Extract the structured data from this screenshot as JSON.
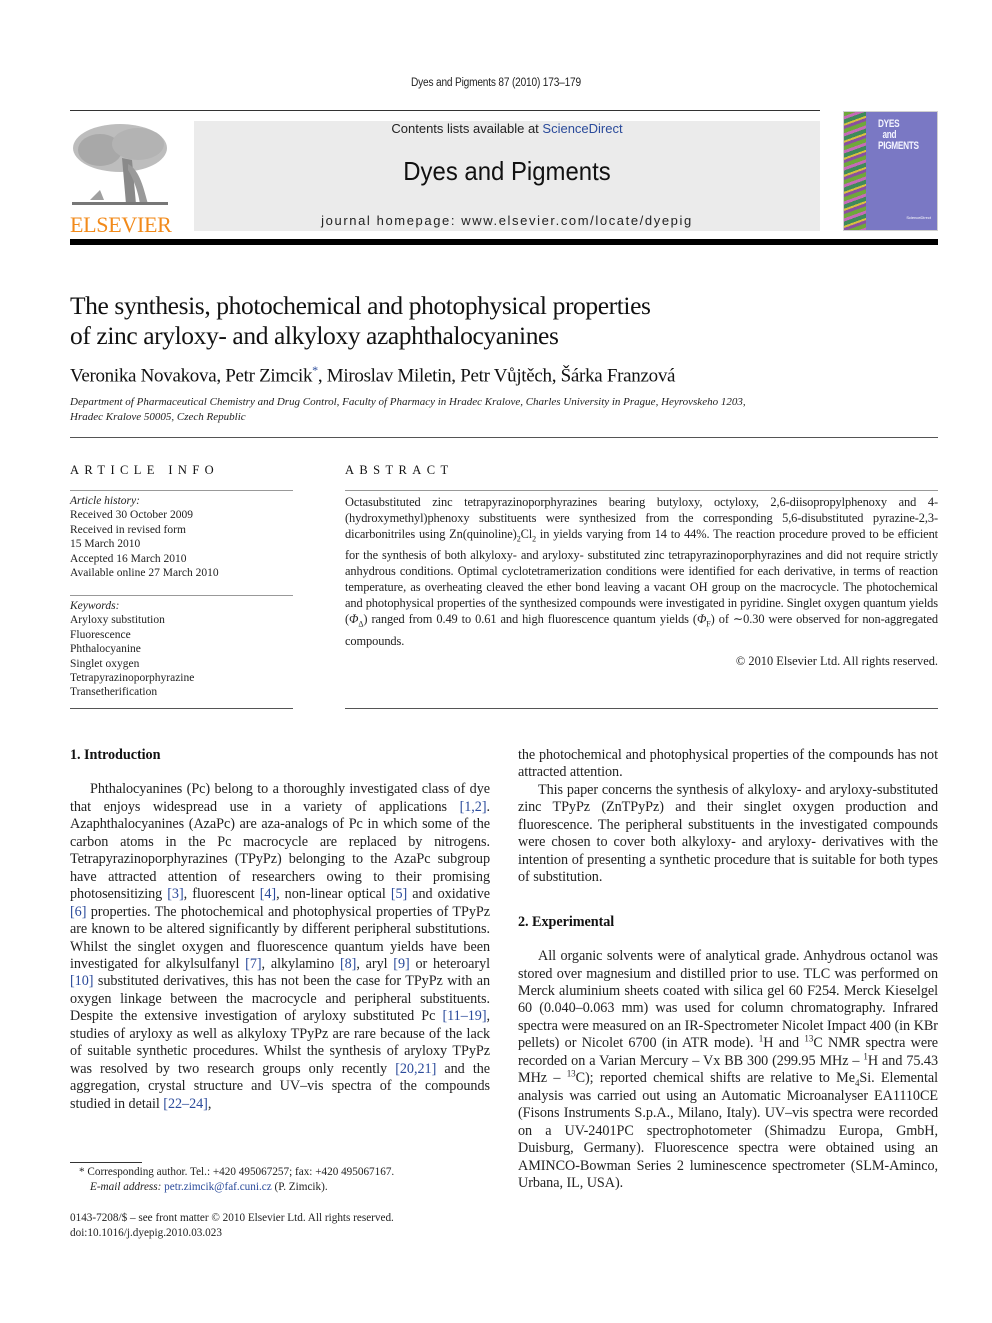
{
  "running_head": "Dyes and Pigments 87 (2010) 173–179",
  "header": {
    "publisher_logo_text": "ELSEVIER",
    "contents_prefix": "Contents lists available at ",
    "contents_link": "ScienceDirect",
    "journal_title": "Dyes and Pigments",
    "homepage_label": "journal homepage: www.elsevier.com/locate/dyepig",
    "cover_title_lines": [
      "DYES",
      "and",
      "PIGMENTS"
    ],
    "cover_footer": "ScienceDirect",
    "colors": {
      "elsevier_orange": "#f28a1a",
      "link_blue": "#2a4a9a",
      "banner_grey": "#ebebeb",
      "cover_purple": "#7a78c4"
    }
  },
  "article": {
    "title_line1": "The synthesis, photochemical and photophysical properties",
    "title_line2": "of zinc aryloxy- and alkyloxy azaphthalocyanines",
    "authors": [
      {
        "name": "Veronika Novakova",
        "sep": ", "
      },
      {
        "name": "Petr Zimcik",
        "mark": "*",
        "sep": ", "
      },
      {
        "name": "Miroslav Miletin",
        "sep": ", "
      },
      {
        "name": "Petr Vůjtěch",
        "sep": ", "
      },
      {
        "name": "Šárka Franzová",
        "sep": ""
      }
    ],
    "affiliation_line1": "Department of Pharmaceutical Chemistry and Drug Control, Faculty of Pharmacy in Hradec Kralove, Charles University in Prague, Heyrovskeho 1203,",
    "affiliation_line2": "Hradec Kralove 50005, Czech Republic"
  },
  "article_info": {
    "heading": "ARTICLE INFO",
    "history_label": "Article history:",
    "history": [
      "Received 30 October 2009",
      "Received in revised form",
      "15 March 2010",
      "Accepted 16 March 2010",
      "Available online 27 March 2010"
    ],
    "keywords_label": "Keywords:",
    "keywords": [
      "Aryloxy substitution",
      "Fluorescence",
      "Phthalocyanine",
      "Singlet oxygen",
      "Tetrapyrazinoporphyrazine",
      "Transetherification"
    ]
  },
  "abstract": {
    "heading": "ABSTRACT",
    "text_a": "Octasubstituted zinc tetrapyrazinoporphyrazines bearing butyloxy, octyloxy, 2,6-diisopropylphenoxy and 4-(hydroxymethyl)phenoxy substituents were synthesized from the corresponding 5,6-disubstituted pyrazine-2,3-dicarbonitriles using Zn(quinoline)",
    "sub_2": "2",
    "text_b": "Cl",
    "text_c": " in yields varying from 14 to 44%. The reaction procedure proved to be efficient for the synthesis of both alkyloxy- and aryloxy- substituted zinc tetrapyrazinoporphyrazines and did not require strictly anhydrous conditions. Optimal cyclotetramerization conditions were identified for each derivative, in terms of reaction temperature, as overheating cleaved the ether bond leaving a vacant OH group on the macrocycle. The photochemical and photophysical properties of the synthesized compounds were investigated in pyridine. Singlet oxygen quantum yields (",
    "phi": "Φ",
    "delta": "Δ",
    "text_d": ") ranged from 0.49 to 0.61 and high fluorescence quantum yields (",
    "F": "F",
    "text_e": ") of ∼0.30 were observed for non-aggregated compounds.",
    "copyright": "© 2010 Elsevier Ltd. All rights reserved."
  },
  "body": {
    "intro_heading": "1.  Introduction",
    "intro_p1": [
      {
        "t": "Phthalocyanines (Pc) belong to a thoroughly investigated class of dye that enjoys widespread use in a variety of applications "
      },
      {
        "ref": "[1,2]"
      },
      {
        "t": ". Azaphthalocyanines (AzaPc) are aza-analogs of Pc in which some of the carbon atoms in the Pc macrocycle are replaced by nitrogens. Tetrapyrazinoporphyrazines (TPyPz) belonging to the AzaPc subgroup have attracted attention of researchers owing to their promising photosensitizing "
      },
      {
        "ref": "[3]"
      },
      {
        "t": ", fluorescent "
      },
      {
        "ref": "[4]"
      },
      {
        "t": ", non-linear optical "
      },
      {
        "ref": "[5]"
      },
      {
        "t": " and oxidative "
      },
      {
        "ref": "[6]"
      },
      {
        "t": " properties. The photochemical and photophysical properties of TPyPz are known to be altered significantly by different peripheral substitutions. Whilst the singlet oxygen and fluorescence quantum yields have been investigated for alkylsulfanyl "
      },
      {
        "ref": "[7]"
      },
      {
        "t": ", alkylamino "
      },
      {
        "ref": "[8]"
      },
      {
        "t": ", aryl "
      },
      {
        "ref": "[9]"
      },
      {
        "t": " or heteroaryl "
      },
      {
        "ref": "[10]"
      },
      {
        "t": " substituted derivatives, this has not been the case for TPyPz with an oxygen linkage between the macrocycle and peripheral substituents. Despite the extensive investigation of aryloxy substituted Pc "
      },
      {
        "ref": "[11–19]"
      },
      {
        "t": ", studies of aryloxy as well as alkyloxy TPyPz are rare because of the lack of suitable synthetic procedures. Whilst the synthesis of aryloxy TPyPz was resolved by two research groups only recently "
      },
      {
        "ref": "[20,21]"
      },
      {
        "t": " and the aggregation, crystal structure and UV–vis spectra of the compounds studied in detail "
      },
      {
        "ref": "[22–24]"
      },
      {
        "t": ","
      }
    ],
    "intro_cont": "the photochemical and photophysical properties of the compounds has not attracted attention.",
    "intro_p2": "This paper concerns the synthesis of alkyloxy- and aryloxy-substituted zinc TPyPz (ZnTPyPz) and their singlet oxygen production and fluorescence. The peripheral substituents in the investigated compounds were chosen to cover both alkyloxy- and aryloxy- derivatives with the intention of presenting a synthetic procedure that is suitable for both types of substitution.",
    "exp_heading": "2.  Experimental",
    "exp_p1": [
      {
        "t": "All organic solvents were of analytical grade. Anhydrous octanol was stored over magnesium and distilled prior to use. TLC was performed on Merck aluminium sheets coated with silica gel 60 F254. Merck Kieselgel 60 (0.040–0.063 mm) was used for column chromatography. Infrared spectra were measured on an IR-Spectrometer Nicolet Impact 400 (in KBr pellets) or Nicolet 6700 (in ATR mode). "
      },
      {
        "sup": "1"
      },
      {
        "t": "H and "
      },
      {
        "sup": "13"
      },
      {
        "t": "C NMR spectra were recorded on a Varian Mercury – Vx BB 300 (299.95 MHz – "
      },
      {
        "sup": "1"
      },
      {
        "t": "H and 75.43 MHz – "
      },
      {
        "sup": "13"
      },
      {
        "t": "C); reported chemical shifts are relative to Me"
      },
      {
        "sub": "4"
      },
      {
        "t": "Si. Elemental analysis was carried out using an Automatic Microanalyser EA1110CE (Fisons Instruments S.p.A., Milano, Italy). UV–vis spectra were recorded on a UV-2401PC spectrophotometer (Shimadzu Europa, GmbH, Duisburg, Germany). Fluorescence spectra were obtained using an AMINCO-Bowman Series 2 luminescence spectrometer (SLM-Aminco, Urbana, IL, USA)."
      }
    ]
  },
  "footnotes": {
    "corresponding": "* Corresponding author. Tel.: +420 495067257; fax: +420 495067167.",
    "email_label": "E-mail address: ",
    "email": "petr.zimcik@faf.cuni.cz",
    "email_suffix": " (P. Zimcik).",
    "front_matter": "0143-7208/$ – see front matter © 2010 Elsevier Ltd. All rights reserved.",
    "doi": "doi:10.1016/j.dyepig.2010.03.023"
  }
}
